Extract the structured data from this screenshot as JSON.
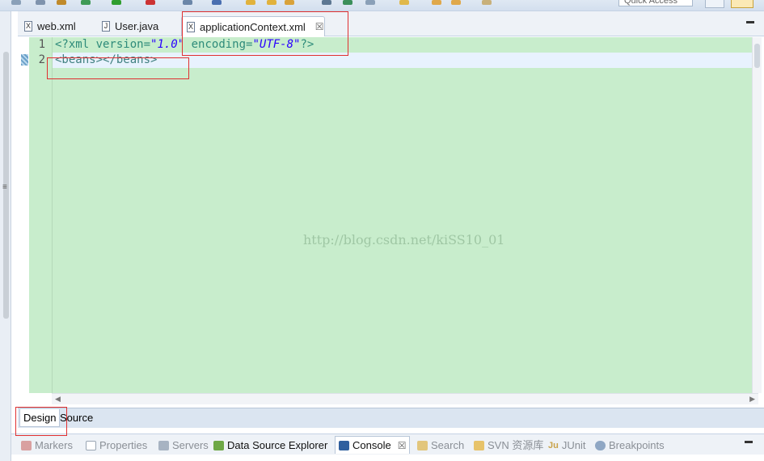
{
  "toolbar": {
    "quick_access_placeholder": "Quick Access"
  },
  "editor_tabs": [
    {
      "label": "web.xml",
      "icon": "xml-file-icon",
      "icon_glyph": "X"
    },
    {
      "label": "User.java",
      "icon": "java-file-icon",
      "icon_glyph": "J"
    },
    {
      "label": "applicationContext.xml",
      "icon": "xml-file-icon",
      "icon_glyph": "X",
      "active": true,
      "close": "☒"
    }
  ],
  "editor": {
    "line_numbers": [
      "1",
      "2"
    ],
    "line1": {
      "pi_open": "<?xml version=",
      "version_value": "\"1.0\"",
      "encoding_attr": " encoding=",
      "encoding_value": "\"UTF-8\"",
      "pi_close": "?>"
    },
    "line2": "<beans></beans>",
    "watermark": "http://blog.csdn.net/kiSS10_01",
    "background_color": "#c8edcc"
  },
  "bottom_tabs": {
    "design": "Design",
    "source": "Source"
  },
  "views": [
    {
      "label": "Markers",
      "icon": "markers-icon"
    },
    {
      "label": "Properties",
      "icon": "properties-icon"
    },
    {
      "label": "Servers",
      "icon": "servers-icon"
    },
    {
      "label": "Data Source Explorer",
      "icon": "data-source-icon"
    },
    {
      "label": "Console",
      "icon": "console-icon",
      "active": true,
      "close": "☒"
    },
    {
      "label": "Search",
      "icon": "search-icon"
    },
    {
      "label": "SVN 资源库",
      "icon": "svn-icon"
    },
    {
      "label": "JUnit",
      "icon": "junit-icon",
      "icon_glyph": "Ju"
    },
    {
      "label": "Breakpoints",
      "icon": "breakpoints-icon"
    }
  ]
}
